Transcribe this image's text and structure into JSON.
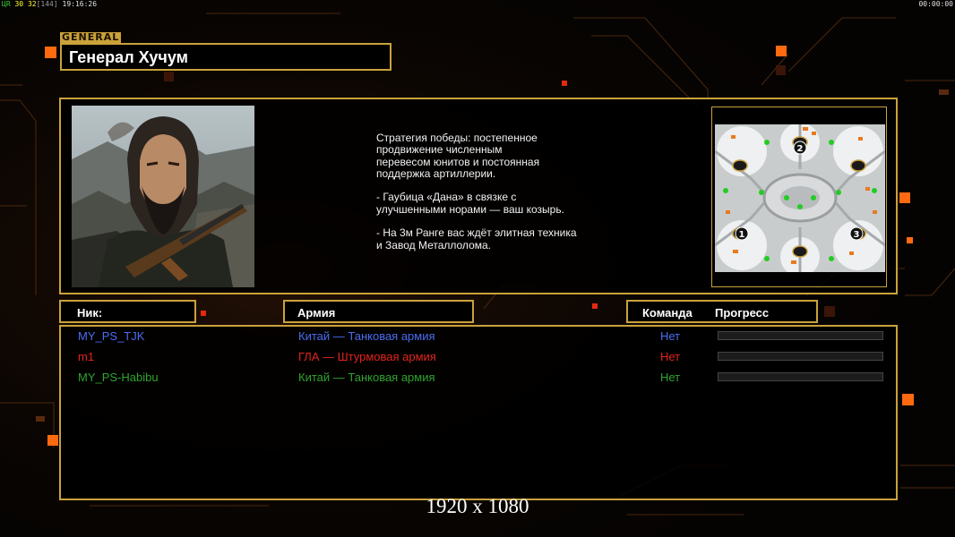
{
  "hud": {
    "tag_a": "ЦR",
    "num_a": "30",
    "num_b": "32",
    "num_c": "[144]",
    "clock": "19:16:26",
    "timer": "00:00:00"
  },
  "general": {
    "tag": "GENERAL",
    "name": "Генерал Хучум",
    "strategy": "Стратегия победы: постепенное\nпродвижение численным\nперевесом юнитов и постоянная\nподдержка артиллерии.\n\n- Гаубица «Дана» в связке с\nулучшенными норами — ваш козырь.\n\n- На 3м Ранге вас ждёт элитная техника\nи Завод Металлолома."
  },
  "minimap": {
    "start_positions": [
      "1",
      "2",
      "3"
    ]
  },
  "headers": {
    "nick": "Ник:",
    "army": "Армия",
    "team": "Команда",
    "progress": "Прогресс"
  },
  "players": [
    {
      "nick": "MY_PS_TJK",
      "army": "Китай — Танковая армия",
      "team": "Нет",
      "color": "#4a6ef0",
      "progress": 0
    },
    {
      "nick": "m1",
      "army": "ГЛА — Штурмовая армия",
      "team": "Нет",
      "color": "#e2241c",
      "progress": 0
    },
    {
      "nick": "MY_PS-Habibu",
      "army": "Китай — Танковая армия",
      "team": "Нет",
      "color": "#2ea52e",
      "progress": 0
    }
  ],
  "resolution": "1920 x 1080",
  "colors": {
    "accent": "#caa23a",
    "glow": "#ff6a10",
    "background": "#050302"
  }
}
